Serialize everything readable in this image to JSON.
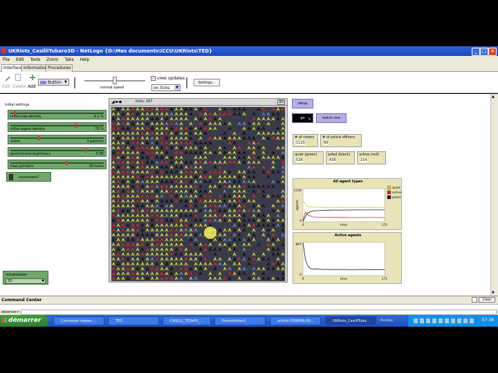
{
  "window": {
    "title": "UKRiots_CasilliTubaro3D - NetLogo {D:\\Mes documents\\ICCU\\UKRiots\\TED}",
    "controls": [
      "minimize-icon",
      "maximize-icon",
      "close-icon"
    ]
  },
  "menu": [
    "File",
    "Edit",
    "Tools",
    "Zoom",
    "Tabs",
    "Help"
  ],
  "tabs": [
    "Interface",
    "Information",
    "Procedures"
  ],
  "toolbar": {
    "edit": "Edit",
    "delete": "Delete",
    "add": "Add",
    "widget_type": "Button",
    "speed_label": "normal speed",
    "speed_level": 0.5,
    "view_updates_label": "view updates",
    "view_updates_checked": true,
    "update_mode": "on ticks",
    "settings": "Settings..."
  },
  "initial_settings": {
    "heading": "Initial settings",
    "sliders": [
      {
        "name": "initial-cop-density",
        "value": "4.1 %",
        "level": 0.04
      },
      {
        "name": "initial-agent-density",
        "value": "70 %",
        "level": 0.7
      },
      {
        "name": "vision",
        "value": "3 patches",
        "level": 0.3
      },
      {
        "name": "government-legitimacy",
        "value": "0.80",
        "level": 0.8
      },
      {
        "name": "max-jail-term",
        "value": "30 turns",
        "level": 0.6
      }
    ],
    "movement_label": "movement?",
    "movement_on": false
  },
  "visualization": {
    "label": "visualization",
    "value": "3D"
  },
  "view": {
    "ticks_label": "ticks: 167",
    "button_3d": "3D"
  },
  "buttons": {
    "setup": "setup",
    "go": "go",
    "watch_one": "watch one"
  },
  "monitors": [
    {
      "label": "# of rioters",
      "value": "1120"
    },
    {
      "label": "# of police officers",
      "value": "66"
    },
    {
      "label": "quiet (green)",
      "value": "528"
    },
    {
      "label": "jailed (black)",
      "value": "438"
    },
    {
      "label": "active (red)",
      "value": "154"
    }
  ],
  "colors": {
    "quiet": "#c8cc3a",
    "active": "#cc2828",
    "jailed": "#111111",
    "cop": "#5a8ab4",
    "patch": "#3a3a4a"
  },
  "chart_data": [
    {
      "type": "line",
      "title": "All agent types",
      "xlabel": "time",
      "ylabel": "agents",
      "ylim": [
        0,
        1230
      ],
      "xlim": [
        0,
        171
      ],
      "ytick_labels": [
        "1230",
        "0"
      ],
      "xtick_labels": [
        "0",
        "171"
      ],
      "x": [
        0,
        5,
        10,
        20,
        40,
        60,
        80,
        100,
        120,
        140,
        160,
        171
      ],
      "series": [
        {
          "name": "quiet",
          "color": "#c8cc3a",
          "values": [
            780,
            640,
            560,
            540,
            530,
            525,
            530,
            528,
            526,
            530,
            528,
            528
          ]
        },
        {
          "name": "active",
          "color": "#cc2828",
          "values": [
            60,
            350,
            260,
            180,
            165,
            158,
            160,
            155,
            152,
            156,
            154,
            154
          ]
        },
        {
          "name": "jailed",
          "color": "#111111",
          "values": [
            0,
            200,
            330,
            400,
            420,
            430,
            432,
            436,
            437,
            438,
            438,
            438
          ]
        }
      ],
      "legend": "right"
    },
    {
      "type": "line",
      "title": "Active agents",
      "xlabel": "time",
      "ylabel": "",
      "ylim": [
        0,
        867
      ],
      "xlim": [
        0,
        171
      ],
      "ytick_labels": [
        "867",
        "0"
      ],
      "xtick_labels": [
        "0",
        "171"
      ],
      "x": [
        0,
        2,
        5,
        10,
        15,
        20,
        30,
        40,
        50,
        60,
        80,
        100,
        120,
        140,
        160,
        171
      ],
      "series": [
        {
          "name": "active",
          "color": "#111111",
          "values": [
            867,
            700,
            420,
            260,
            190,
            170,
            175,
            160,
            165,
            158,
            162,
            155,
            160,
            157,
            154,
            154
          ]
        }
      ]
    }
  ],
  "command_center": {
    "title": "Command Center",
    "clear": "Clear",
    "observer_label": "observer>"
  },
  "taskbar": {
    "start": "démarrer",
    "tasks": [
      {
        "label": "Connexion réseau ...",
        "active": false
      },
      {
        "label": "TED",
        "active": false
      },
      {
        "label": "CASILLI_TEDxPU_...",
        "active": false
      },
      {
        "label": "Présentation1",
        "active": false
      },
      {
        "label": "article-1359096-00...",
        "active": false
      },
      {
        "label": "UKRiots_CasilliTuba...",
        "active": true
      }
    ],
    "bureau": "Bureau",
    "clock": "07:38"
  }
}
